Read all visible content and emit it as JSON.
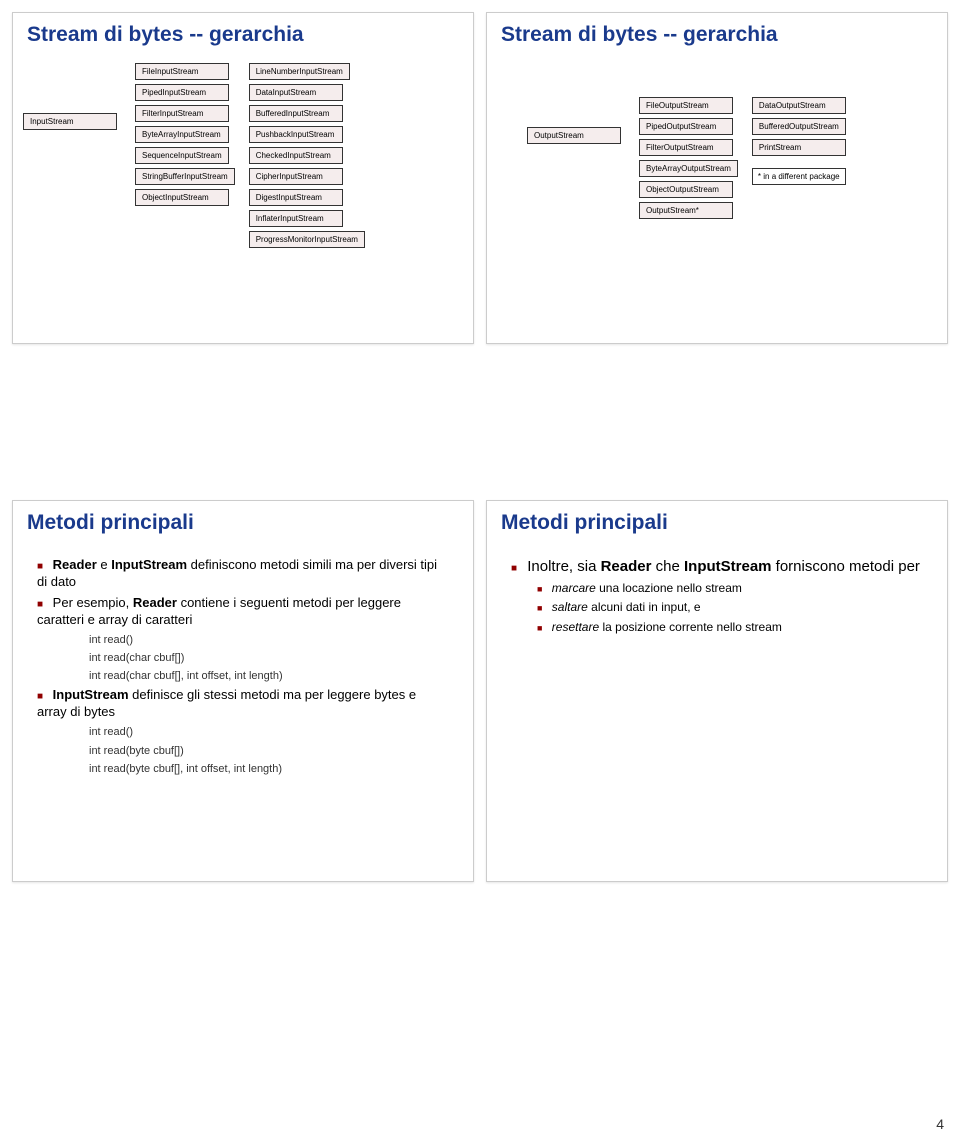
{
  "slides": {
    "tl": {
      "title": "Stream di bytes -- gerarchia",
      "root": "InputStream",
      "col2": [
        "FileInputStream",
        "PipedInputStream",
        "FilterInputStream",
        "ByteArrayInputStream",
        "SequenceInputStream",
        "StringBufferInputStream",
        "ObjectInputStream"
      ],
      "col3": [
        "LineNumberInputStream",
        "DataInputStream",
        "BufferedInputStream",
        "PushbackInputStream",
        "CheckedInputStream",
        "CipherInputStream",
        "DigestInputStream",
        "InflaterInputStream",
        "ProgressMonitorInputStream"
      ]
    },
    "tr": {
      "title": "Stream di bytes -- gerarchia",
      "root": "OutputStream",
      "col2": [
        "FileOutputStream",
        "PipedOutputStream",
        "FilterOutputStream",
        "ByteArrayOutputStream",
        "ObjectOutputStream",
        "OutputStream*"
      ],
      "col3": [
        "DataOutputStream",
        "BufferedOutputStream",
        "PrintStream"
      ],
      "note": "* in a different package"
    },
    "bl": {
      "title": "Metodi principali",
      "b1_before": "Reader",
      "b1_mid": " e ",
      "b1_bold2": "InputStream",
      "b1_after": " definiscono metodi simili ma per diversi tipi di dato",
      "b2_before": "Per esempio, ",
      "b2_bold": "Reader",
      "b2_after": " contiene i seguenti metodi per leggere caratteri e array di caratteri",
      "c1": "int read()",
      "c2": "int read(char cbuf[])",
      "c3": "int read(char cbuf[], int offset, int length)",
      "b3_bold": "InputStream",
      "b3_after": " definisce gli stessi metodi ma per leggere bytes e array di bytes",
      "c4": "int read()",
      "c5": "int read(byte cbuf[])",
      "c6": "int read(byte cbuf[], int offset, int length)"
    },
    "br": {
      "title": "Metodi principali",
      "b1_before": "Inoltre, sia ",
      "b1_bold1": "Reader",
      "b1_mid": " che ",
      "b1_bold2": "InputStream",
      "b1_after": " forniscono metodi per",
      "s1_i": "marcare",
      "s1_after": " una locazione nello stream",
      "s2_i": "saltare",
      "s2_after": " alcuni dati in input, e",
      "s3_i": "resettare",
      "s3_after": " la posizione corrente nello stream"
    }
  },
  "page_number": "4"
}
